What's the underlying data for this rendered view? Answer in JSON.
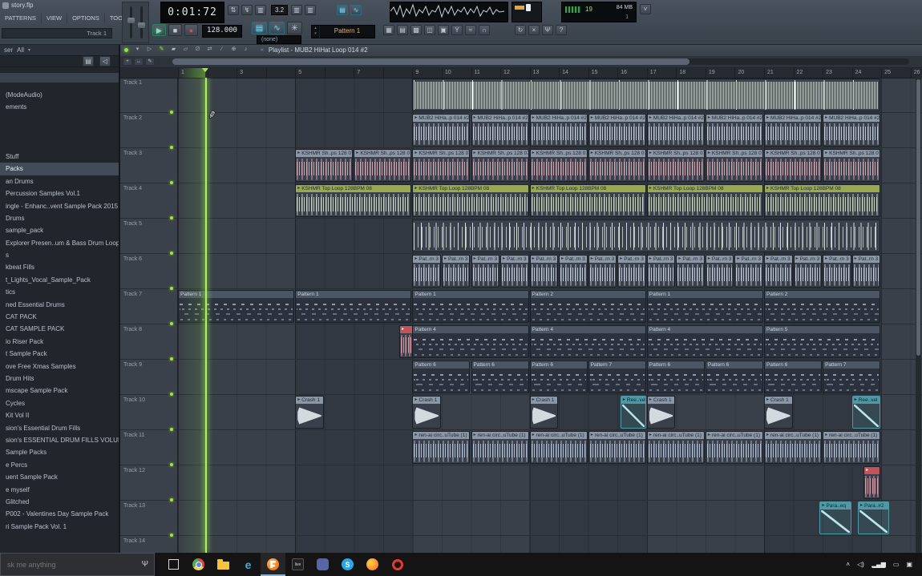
{
  "titlebar": {
    "app_title": "story.flp",
    "menus": [
      "PATTERNS",
      "VIEW",
      "OPTIONS",
      "TOOLS",
      "?"
    ],
    "track_strip": "Track 1",
    "lcd_time": "0:01:72",
    "cluster_value": "3.2",
    "tempo": "128.000",
    "none_box": "(none)",
    "pattern_box": "Pattern 1",
    "cpu": {
      "percent": "19",
      "mem": "84 MB",
      "voices": "1"
    },
    "iconsA1": [
      {
        "name": "updown-arrows-icon",
        "g": "⇅"
      },
      {
        "name": "lightning-icon",
        "g": "↯"
      },
      {
        "name": "step-bars-icon",
        "g": "▥"
      }
    ],
    "iconsA2": [
      {
        "name": "step-bars-plus-icon",
        "g": "▥"
      },
      {
        "name": "step-bars-circle-icon",
        "g": "▥"
      }
    ],
    "iconsCyan": [
      {
        "name": "typing-keyboard-icon",
        "g": "▤",
        "cls": "lit-c"
      },
      {
        "name": "midi-activity-icon",
        "g": "∿",
        "cls": "lit-c"
      }
    ],
    "transport": [
      {
        "name": "play-button",
        "g": "▶",
        "cls": "lit"
      },
      {
        "name": "stop-button",
        "g": "■"
      },
      {
        "name": "record-button",
        "g": "●",
        "cls": "rec"
      }
    ],
    "blueBtns": [
      {
        "name": "remote-control-icon",
        "g": "▤",
        "cls": "big lit-c"
      },
      {
        "name": "plug-icon",
        "g": "∿",
        "cls": "big lit-c"
      },
      {
        "name": "wrench-icon",
        "g": "✳",
        "cls": "big"
      }
    ],
    "toolrowB": [
      {
        "name": "pattern-mode-icon",
        "g": "▦"
      },
      {
        "name": "song-mode-icon",
        "g": "▤"
      },
      {
        "name": "grid-icon",
        "g": "▩"
      },
      {
        "name": "stack-icon",
        "g": "◫"
      },
      {
        "name": "file-icon",
        "g": "▣"
      },
      {
        "name": "funnel-icon",
        "g": "Y"
      },
      {
        "name": "wave-edit-icon",
        "g": "≈"
      },
      {
        "name": "snap-magnet-icon",
        "g": "∩"
      }
    ],
    "toolrowC": [
      {
        "name": "refresh-icon",
        "g": "↻"
      },
      {
        "name": "close-tool-icon",
        "g": "×"
      },
      {
        "name": "mic-icon",
        "g": "Ψ"
      },
      {
        "name": "help-icon",
        "g": "?"
      }
    ],
    "corner": [
      {
        "name": "chevron-down-icon",
        "g": "˅"
      }
    ]
  },
  "playlist_bar": {
    "title": "Playlist - MUB2 HiHat Loop 014 #2",
    "nav_glyph": "«",
    "tools": [
      {
        "name": "menu-chevron-icon",
        "g": "▾"
      },
      {
        "name": "select-icon",
        "g": "▷"
      },
      {
        "name": "draw-icon",
        "g": "✎",
        "cls": "lit"
      },
      {
        "name": "paint-icon",
        "g": "▰"
      },
      {
        "name": "delete-icon",
        "g": "▱"
      },
      {
        "name": "mute-icon",
        "g": "∅"
      },
      {
        "name": "slip-icon",
        "g": "⇄"
      },
      {
        "name": "slice-icon",
        "g": "∕"
      },
      {
        "name": "zoom-icon",
        "g": "⊕"
      },
      {
        "name": "preview-icon",
        "g": "♪"
      }
    ],
    "subtools": [
      {
        "name": "add-icon",
        "g": "+"
      },
      {
        "name": "h-move-icon",
        "g": "↔"
      },
      {
        "name": "pencil-small-icon",
        "g": "✎"
      }
    ]
  },
  "browser": {
    "panel_label": "ser",
    "filter_label": "All",
    "tools": [
      {
        "name": "file-small-icon",
        "g": "▤"
      },
      {
        "name": "speaker-small-icon",
        "g": "◁"
      }
    ],
    "items": [
      "(ModeAudio)",
      "ements",
      "",
      "",
      "",
      "Stuff",
      "Packs",
      "an Drums",
      "Percussion Samples Vol.1",
      "ingle - Enhanc..vent Sample Pack 2015",
      "Drums",
      "sample_pack",
      "Explorer Presen..um & Bass Drum Loops",
      "s",
      "kbeat Fills",
      "t_Lights_Vocal_Sample_Pack",
      "tics",
      "ned Essential Drums",
      "CAT PACK",
      "CAT SAMPLE PACK",
      "io Riser Pack",
      "t Sample Pack",
      "ove Free Xmas Samples",
      "Drum Hits",
      "mscape Sample Pack",
      "Cycles",
      "Kit Vol II",
      "sion's Essential Drum Fills",
      "sion's ESSENTIAL DRUM FILLS VOLUME 2",
      "Sample Packs",
      "e Percs",
      "uent Sample Pack",
      "e myself",
      "Glitched",
      "P002 - Valentines Day Sample Pack",
      "ri Sample Pack Vol. 1"
    ]
  },
  "ruler": [
    "1",
    "",
    "3",
    "",
    "5",
    "",
    "7",
    "",
    "9",
    "10",
    "11",
    "12",
    "13",
    "14",
    "15",
    "16",
    "17",
    "18",
    "19",
    "20",
    "21",
    "22",
    "23",
    "24",
    "25",
    "26"
  ],
  "playhead": {
    "bar": 1.93
  },
  "tracks": [
    {
      "name": "Track 1",
      "clips": [
        {
          "type": "wave-dense",
          "label": "",
          "start": 9,
          "len": 16
        }
      ]
    },
    {
      "name": "Track 2",
      "clips": [
        {
          "type": "audio",
          "wf": "gray",
          "label": "MUB2 HiHa..p 014 #2",
          "start": 9,
          "len": 2
        },
        {
          "type": "audio",
          "wf": "gray",
          "label": "MUB2 HiHa..p 014 #2",
          "start": 11,
          "len": 2
        },
        {
          "type": "audio",
          "wf": "gray",
          "label": "MUB2 HiHa..p 014 #2",
          "start": 13,
          "len": 2
        },
        {
          "type": "audio",
          "wf": "gray",
          "label": "MUB2 HiHa..p 014 #2",
          "start": 15,
          "len": 2
        },
        {
          "type": "audio",
          "wf": "gray",
          "label": "MUB2 HiHa..p 014 #2",
          "start": 17,
          "len": 2
        },
        {
          "type": "audio",
          "wf": "gray",
          "label": "MUB2 HiHa..p 014 #2",
          "start": 19,
          "len": 2
        },
        {
          "type": "audio",
          "wf": "gray",
          "label": "MUB2 HiHa..p 014 #2",
          "start": 21,
          "len": 2
        },
        {
          "type": "audio",
          "wf": "gray",
          "label": "MUB2 HiHa..p 014 #2",
          "start": 23,
          "len": 2
        }
      ]
    },
    {
      "name": "Track 3",
      "clips": [
        {
          "type": "audio",
          "wf": "pink",
          "label": "KSHMR Sh..ps 128 07",
          "start": 5,
          "len": 2
        },
        {
          "type": "audio",
          "wf": "pink",
          "label": "KSHMR Sh..ps 128 07",
          "start": 7,
          "len": 2
        },
        {
          "type": "audio",
          "wf": "pink",
          "label": "KSHMR Sh..ps 128 07",
          "start": 9,
          "len": 2
        },
        {
          "type": "audio",
          "wf": "pink",
          "label": "KSHMR Sh..ps 128 07",
          "start": 11,
          "len": 2
        },
        {
          "type": "audio",
          "wf": "pink",
          "label": "KSHMR Sh..ps 128 07",
          "start": 13,
          "len": 2
        },
        {
          "type": "audio",
          "wf": "pink",
          "label": "KSHMR Sh..ps 128 07",
          "start": 15,
          "len": 2
        },
        {
          "type": "audio",
          "wf": "pink",
          "label": "KSHMR Sh..ps 128 07",
          "start": 17,
          "len": 2
        },
        {
          "type": "audio",
          "wf": "pink",
          "label": "KSHMR Sh..ps 128 07",
          "start": 19,
          "len": 2
        },
        {
          "type": "audio",
          "wf": "pink",
          "label": "KSHMR Sh..ps 128 07",
          "start": 21,
          "len": 2
        },
        {
          "type": "audio",
          "wf": "pink",
          "label": "KSHMR Sh..ps 128 07",
          "start": 23,
          "len": 2
        }
      ]
    },
    {
      "name": "Track 4",
      "clips": [
        {
          "type": "audio",
          "wf": "green",
          "hdr": "green",
          "label": "KSHMR Top Loop 128BPM 08",
          "start": 5,
          "len": 4
        },
        {
          "type": "audio",
          "wf": "green",
          "hdr": "green",
          "label": "KSHMR Top Loop 128BPM 08",
          "start": 9,
          "len": 4
        },
        {
          "type": "audio",
          "wf": "green",
          "hdr": "green",
          "label": "KSHMR Top Loop 128BPM 08",
          "start": 13,
          "len": 4
        },
        {
          "type": "audio",
          "wf": "green",
          "hdr": "green",
          "label": "KSHMR Top Loop 128BPM 08",
          "start": 17,
          "len": 4
        },
        {
          "type": "audio",
          "wf": "green",
          "hdr": "green",
          "label": "KSHMR Top Loop 128BPM 08",
          "start": 21,
          "len": 4
        }
      ]
    },
    {
      "name": "Track 5",
      "clips": [
        {
          "type": "wave-spikes",
          "label": "",
          "start": 9,
          "len": 16
        }
      ]
    },
    {
      "name": "Track 6",
      "clips": [
        {
          "type": "audio",
          "wf": "gray",
          "label": "Pat..rn 3",
          "start": 9,
          "len": 1
        },
        {
          "type": "audio",
          "wf": "gray",
          "label": "Pat..rn 3",
          "start": 10,
          "len": 1
        },
        {
          "type": "audio",
          "wf": "gray",
          "label": "Pat..rn 3",
          "start": 11,
          "len": 1
        },
        {
          "type": "audio",
          "wf": "gray",
          "label": "Pat..rn 3",
          "start": 12,
          "len": 1
        },
        {
          "type": "audio",
          "wf": "gray",
          "label": "Pat..rn 3",
          "start": 13,
          "len": 1
        },
        {
          "type": "audio",
          "wf": "gray",
          "label": "Pat..rn 3",
          "start": 14,
          "len": 1
        },
        {
          "type": "audio",
          "wf": "gray",
          "label": "Pat..rn 3",
          "start": 15,
          "len": 1
        },
        {
          "type": "audio",
          "wf": "gray",
          "label": "Pat..rn 3",
          "start": 16,
          "len": 1
        },
        {
          "type": "audio",
          "wf": "gray",
          "label": "Pat..rn 3",
          "start": 17,
          "len": 1
        },
        {
          "type": "audio",
          "wf": "gray",
          "label": "Pat..rn 3",
          "start": 18,
          "len": 1
        },
        {
          "type": "audio",
          "wf": "gray",
          "label": "Pat..rn 3",
          "start": 19,
          "len": 1
        },
        {
          "type": "audio",
          "wf": "gray",
          "label": "Pat..rn 3",
          "start": 20,
          "len": 1
        },
        {
          "type": "audio",
          "wf": "gray",
          "label": "Pat..rn 3",
          "start": 21,
          "len": 1
        },
        {
          "type": "audio",
          "wf": "gray",
          "label": "Pat..rn 3",
          "start": 22,
          "len": 1
        },
        {
          "type": "audio",
          "wf": "gray",
          "label": "Pat..rn 3",
          "start": 23,
          "len": 1
        },
        {
          "type": "audio",
          "wf": "gray",
          "label": "Pat..rn 3",
          "start": 24,
          "len": 1
        }
      ]
    },
    {
      "name": "Track 7",
      "clips": [
        {
          "type": "midi",
          "label": "Pattern 1",
          "start": 1,
          "len": 4
        },
        {
          "type": "midi",
          "label": "Pattern 1",
          "start": 5,
          "len": 4
        },
        {
          "type": "midi",
          "label": "Pattern 1",
          "start": 9,
          "len": 4
        },
        {
          "type": "midi",
          "label": "Pattern 2",
          "start": 13,
          "len": 4
        },
        {
          "type": "midi",
          "label": "Pattern 1",
          "start": 17,
          "len": 4
        },
        {
          "type": "midi",
          "label": "Pattern 2",
          "start": 21,
          "len": 4
        }
      ]
    },
    {
      "name": "Track 8",
      "clips": [
        {
          "type": "audio",
          "wf": "red",
          "hdr": "red",
          "label": "",
          "start": 8.55,
          "len": 0.55
        },
        {
          "type": "midi",
          "label": "Pattern 4",
          "start": 9,
          "len": 4
        },
        {
          "type": "midi",
          "label": "Pattern 4",
          "start": 13,
          "len": 4
        },
        {
          "type": "midi",
          "label": "Pattern 4",
          "start": 17,
          "len": 4
        },
        {
          "type": "midi",
          "label": "Pattern 5",
          "start": 21,
          "len": 4
        }
      ]
    },
    {
      "name": "Track 9",
      "clips": [
        {
          "type": "midi",
          "label": "Pattern 6",
          "start": 9,
          "len": 2
        },
        {
          "type": "midi",
          "label": "Pattern 6",
          "start": 11,
          "len": 2
        },
        {
          "type": "midi",
          "label": "Pattern 6",
          "start": 13,
          "len": 2
        },
        {
          "type": "midi",
          "label": "Pattern 7",
          "start": 15,
          "len": 2
        },
        {
          "type": "midi",
          "label": "Pattern 6",
          "start": 17,
          "len": 2
        },
        {
          "type": "midi",
          "label": "Pattern 6",
          "start": 19,
          "len": 2
        },
        {
          "type": "midi",
          "label": "Pattern 6",
          "start": 21,
          "len": 2
        },
        {
          "type": "midi",
          "label": "Pattern 7",
          "start": 23,
          "len": 2
        }
      ]
    },
    {
      "name": "Track 10",
      "clips": [
        {
          "type": "crash",
          "label": "Crash 1",
          "start": 5,
          "len": 1
        },
        {
          "type": "crash",
          "label": "Crash 1",
          "start": 9,
          "len": 1
        },
        {
          "type": "crash",
          "label": "Crash 1",
          "start": 13,
          "len": 1
        },
        {
          "type": "auto",
          "label": "Ree..vel",
          "start": 16.1,
          "len": 0.9
        },
        {
          "type": "crash",
          "label": "Crash 1",
          "start": 17,
          "len": 1
        },
        {
          "type": "crash",
          "label": "Crash 1",
          "start": 21,
          "len": 1
        },
        {
          "type": "auto",
          "label": "Ree..vel",
          "start": 24,
          "len": 1
        }
      ]
    },
    {
      "name": "Track 11",
      "clips": [
        {
          "type": "audio",
          "wf": "blue",
          "label": "ren-ai circ..uTube (1)",
          "start": 9,
          "len": 2
        },
        {
          "type": "audio",
          "wf": "blue",
          "label": "ren-ai circ..uTube (1)",
          "start": 11,
          "len": 2
        },
        {
          "type": "audio",
          "wf": "blue",
          "label": "ren-ai circ..uTube (1)",
          "start": 13,
          "len": 2
        },
        {
          "type": "audio",
          "wf": "blue",
          "label": "ren-ai circ..uTube (1)",
          "start": 15,
          "len": 2
        },
        {
          "type": "audio",
          "wf": "blue",
          "label": "ren-ai circ..uTube (1)",
          "start": 17,
          "len": 2
        },
        {
          "type": "audio",
          "wf": "blue",
          "label": "ren-ai circ..uTube (1)",
          "start": 19,
          "len": 2
        },
        {
          "type": "audio",
          "wf": "blue",
          "label": "ren-ai circ..uTube (1)",
          "start": 21,
          "len": 2
        },
        {
          "type": "audio",
          "wf": "blue",
          "label": "ren-ai circ..uTube (1)",
          "start": 23,
          "len": 2
        }
      ]
    },
    {
      "name": "Track 12",
      "clips": [
        {
          "type": "audio",
          "wf": "red",
          "hdr": "red",
          "label": "",
          "start": 24.4,
          "len": 0.6
        }
      ]
    },
    {
      "name": "Track 13",
      "clips": [
        {
          "type": "auto",
          "label": "Para..eq",
          "start": 22.9,
          "len": 1.1
        },
        {
          "type": "auto",
          "label": "Para..#2",
          "start": 24.2,
          "len": 1.1
        }
      ]
    },
    {
      "name": "Track 14",
      "clips": []
    }
  ],
  "taskbar": {
    "search_placeholder": "sk me anything",
    "apps": [
      {
        "name": "task-view-icon"
      },
      {
        "name": "chrome-icon"
      },
      {
        "name": "file-explorer-icon"
      },
      {
        "name": "edge-icon",
        "text": "e"
      },
      {
        "name": "fl-studio-icon",
        "active": true
      },
      {
        "name": "ableton-live-icon",
        "text": "live"
      },
      {
        "name": "discord-icon"
      },
      {
        "name": "skype-icon",
        "text": "S"
      },
      {
        "name": "firefox-icon"
      },
      {
        "name": "opera-icon"
      }
    ],
    "tray": [
      {
        "name": "tray-chevron-icon",
        "g": "˄"
      },
      {
        "name": "tray-volume-icon",
        "g": "◁)"
      },
      {
        "name": "tray-network-icon",
        "g": "▂▄▆"
      },
      {
        "name": "tray-battery-icon",
        "g": "▭"
      },
      {
        "name": "action-center-icon",
        "g": "▣"
      }
    ]
  }
}
